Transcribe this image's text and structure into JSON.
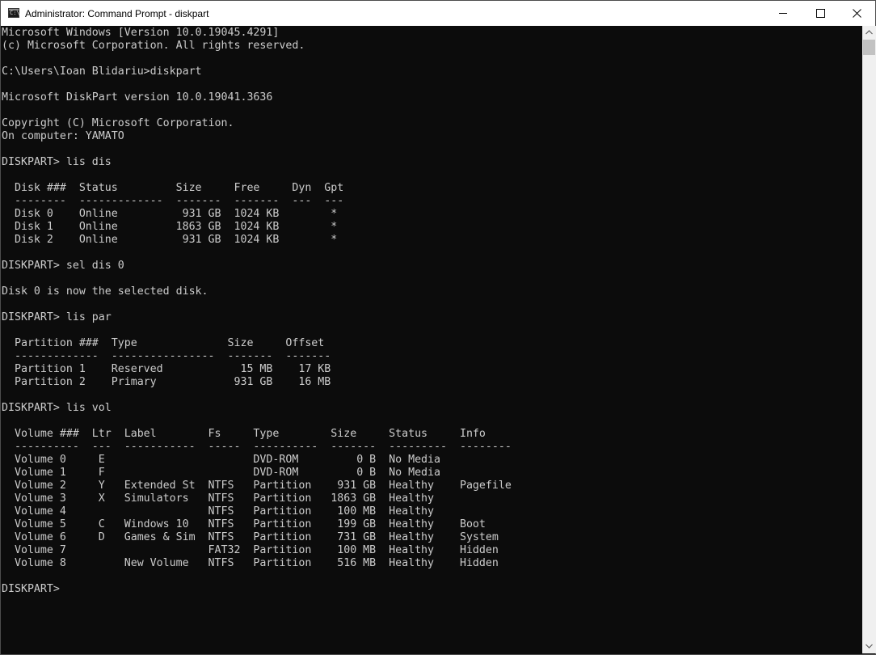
{
  "window": {
    "title": "Administrator: Command Prompt - diskpart",
    "app_icon_glyph": "C:\\",
    "controls": {
      "minimize": "minimize-icon",
      "maximize": "maximize-icon",
      "close": "close-icon"
    }
  },
  "colors": {
    "console_bg": "#0c0c0c",
    "console_text": "#cccccc",
    "titlebar_bg": "#ffffff",
    "scrollbar_bg": "#f0f0f0",
    "scrollbar_thumb": "#c2c2c2"
  },
  "console": {
    "lines": [
      "Microsoft Windows [Version 10.0.19045.4291]",
      "(c) Microsoft Corporation. All rights reserved.",
      "",
      "C:\\Users\\Ioan Blidariu>diskpart",
      "",
      "Microsoft DiskPart version 10.0.19041.3636",
      "",
      "Copyright (C) Microsoft Corporation.",
      "On computer: YAMATO",
      "",
      "DISKPART> lis dis",
      "",
      "  Disk ###  Status         Size     Free     Dyn  Gpt",
      "  --------  -------------  -------  -------  ---  ---",
      "  Disk 0    Online          931 GB  1024 KB        *",
      "  Disk 1    Online         1863 GB  1024 KB        *",
      "  Disk 2    Online          931 GB  1024 KB        *",
      "",
      "DISKPART> sel dis 0",
      "",
      "Disk 0 is now the selected disk.",
      "",
      "DISKPART> lis par",
      "",
      "  Partition ###  Type              Size     Offset",
      "  -------------  ----------------  -------  -------",
      "  Partition 1    Reserved            15 MB    17 KB",
      "  Partition 2    Primary            931 GB    16 MB",
      "",
      "DISKPART> lis vol",
      "",
      "  Volume ###  Ltr  Label        Fs     Type        Size     Status     Info",
      "  ----------  ---  -----------  -----  ----------  -------  ---------  --------",
      "  Volume 0     E                       DVD-ROM         0 B  No Media",
      "  Volume 1     F                       DVD-ROM         0 B  No Media",
      "  Volume 2     Y   Extended St  NTFS   Partition    931 GB  Healthy    Pagefile",
      "  Volume 3     X   Simulators   NTFS   Partition   1863 GB  Healthy",
      "  Volume 4                      NTFS   Partition    100 MB  Healthy",
      "  Volume 5     C   Windows 10   NTFS   Partition    199 GB  Healthy    Boot",
      "  Volume 6     D   Games & Sim  NTFS   Partition    731 GB  Healthy    System",
      "  Volume 7                      FAT32  Partition    100 MB  Healthy    Hidden",
      "  Volume 8         New Volume   NTFS   Partition    516 MB  Healthy    Hidden",
      "",
      "DISKPART> "
    ]
  },
  "scrollbar": {
    "up_icon": "scroll-up-arrow-icon",
    "down_icon": "scroll-down-arrow-icon"
  }
}
